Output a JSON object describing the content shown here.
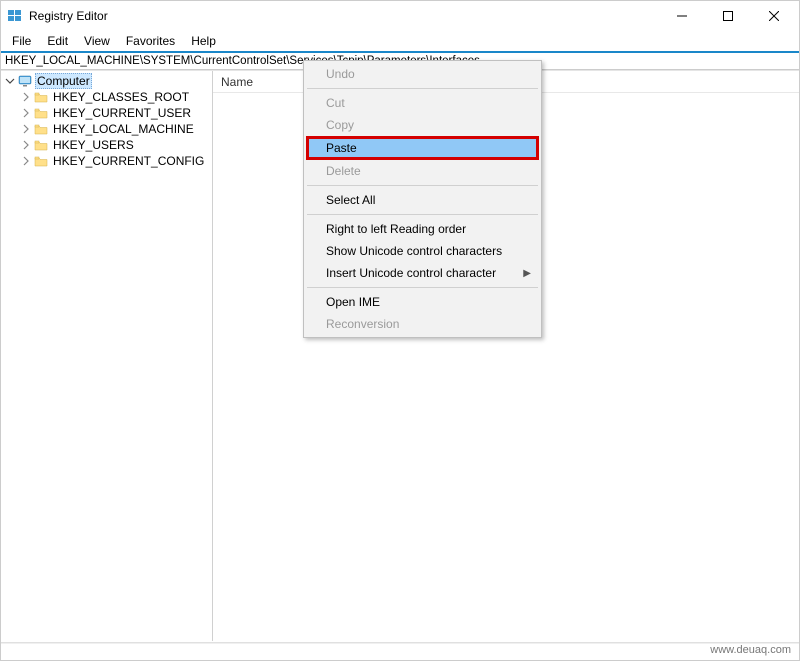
{
  "window": {
    "title": "Registry Editor"
  },
  "menubar": {
    "items": [
      "File",
      "Edit",
      "View",
      "Favorites",
      "Help"
    ]
  },
  "addressbar": {
    "path": "HKEY_LOCAL_MACHINE\\SYSTEM\\CurrentControlSet\\Services\\Tcpip\\Parameters\\Interfaces"
  },
  "tree": {
    "root": {
      "label": "Computer",
      "expanded": true,
      "selected": true,
      "icon": "computer-icon",
      "children": [
        {
          "label": "HKEY_CLASSES_ROOT",
          "icon": "folder-icon"
        },
        {
          "label": "HKEY_CURRENT_USER",
          "icon": "folder-icon"
        },
        {
          "label": "HKEY_LOCAL_MACHINE",
          "icon": "folder-icon"
        },
        {
          "label": "HKEY_USERS",
          "icon": "folder-icon"
        },
        {
          "label": "HKEY_CURRENT_CONFIG",
          "icon": "folder-icon"
        }
      ]
    }
  },
  "list": {
    "columns": [
      "Name"
    ]
  },
  "context_menu": {
    "items": [
      {
        "label": "Undo",
        "enabled": false
      },
      {
        "sep": true
      },
      {
        "label": "Cut",
        "enabled": false
      },
      {
        "label": "Copy",
        "enabled": false
      },
      {
        "label": "Paste",
        "enabled": true,
        "highlight": true
      },
      {
        "label": "Delete",
        "enabled": false
      },
      {
        "sep": true
      },
      {
        "label": "Select All",
        "enabled": true
      },
      {
        "sep": true
      },
      {
        "label": "Right to left Reading order",
        "enabled": true
      },
      {
        "label": "Show Unicode control characters",
        "enabled": true
      },
      {
        "label": "Insert Unicode control character",
        "enabled": true,
        "submenu": true
      },
      {
        "sep": true
      },
      {
        "label": "Open IME",
        "enabled": true
      },
      {
        "label": "Reconversion",
        "enabled": false
      }
    ]
  },
  "watermark": "www.deuaq.com"
}
